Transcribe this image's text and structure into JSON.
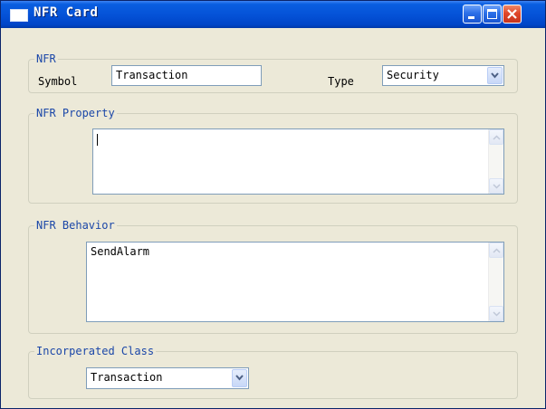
{
  "window": {
    "title": "NFR Card",
    "controls": {
      "minimize": "minimize-icon",
      "maximize": "maximize-icon",
      "close": "close-icon"
    }
  },
  "nfr_group": {
    "legend": "NFR",
    "symbol_label": "Symbol",
    "symbol_value": "Transaction",
    "type_label": "Type",
    "type_value": "Security"
  },
  "property_group": {
    "legend": "NFR Property",
    "value": ""
  },
  "behavior_group": {
    "legend": "NFR Behavior",
    "value": "SendAlarm"
  },
  "class_group": {
    "legend": "Incorperated Class",
    "value": "Transaction"
  },
  "colors": {
    "titlebar": "#0553d8",
    "window_bg": "#ece9d8",
    "legend_text": "#1b47a8",
    "close_button": "#e0472a",
    "field_border": "#7f9db9"
  }
}
